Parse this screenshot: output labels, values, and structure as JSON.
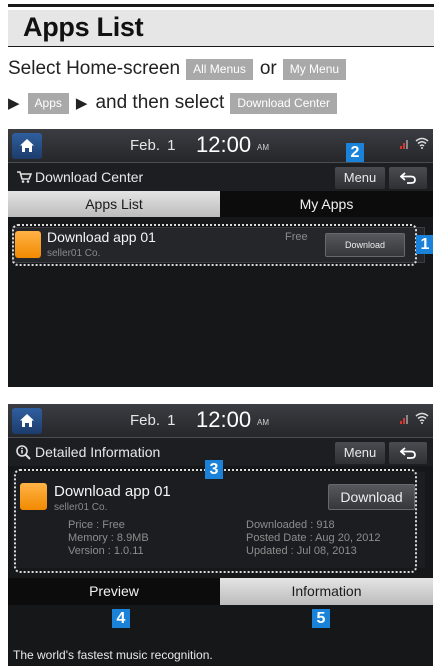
{
  "header": {
    "title": "Apps List",
    "instr_select": "Select Home-screen",
    "chip_all_menus": "All Menus",
    "word_or": "or",
    "chip_my_menu": "My Menu",
    "arrow1": "▶",
    "chip_apps": "Apps",
    "arrow2": "▶",
    "and_then": "and then select",
    "chip_download_center": "Download Center"
  },
  "screen1": {
    "date": "Feb. 1",
    "time": "12:00",
    "ampm": "AM",
    "titlebar_label": "Download Center",
    "menu_label": "Menu",
    "tabs": [
      "Apps List",
      "My Apps"
    ],
    "app": {
      "name": "Download app 01",
      "seller": "seller01 Co.",
      "price_tag": "Free",
      "button": "Download"
    }
  },
  "screen2": {
    "date": "Feb. 1",
    "time": "12:00",
    "ampm": "AM",
    "titlebar_label": "Detailed Information",
    "menu_label": "Menu",
    "app": {
      "name": "Download app 01",
      "seller": "seller01 Co.",
      "button": "Download",
      "price": "Price : Free",
      "memory": "Memory : 8.9MB",
      "version": "Version : 1.0.11",
      "downloaded": "Downloaded : 918",
      "posted": "Posted Date : Aug 20, 2012",
      "updated": "Updated : Jul 08, 2013"
    },
    "tabs": [
      "Preview",
      "Information"
    ],
    "description": "The world's fastest music recognition."
  },
  "callouts": [
    "1",
    "2",
    "3",
    "4",
    "5"
  ],
  "icons": {
    "home": "home-icon",
    "signal": "signal-icon",
    "wifi": "wifi-icon",
    "cart": "cart-icon",
    "info": "info-search-icon",
    "back": "back-arrow-icon"
  },
  "colors": {
    "callout_blue": "#1a82d8",
    "app_icon_orange": "#f39a1a",
    "screen_bg": "#161719",
    "active_tab": "#d6d6d6",
    "chip_gray": "#a9a9a9"
  }
}
